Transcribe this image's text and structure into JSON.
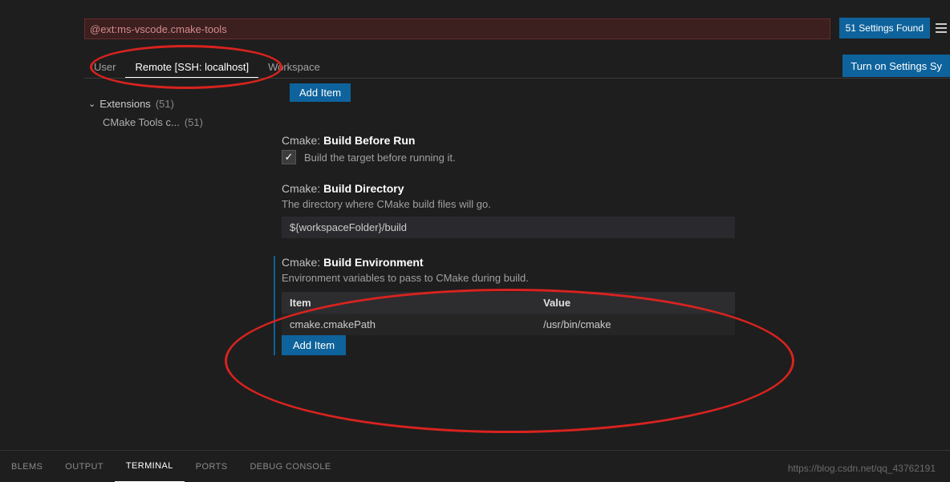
{
  "search": {
    "value": "@ext:ms-vscode.cmake-tools"
  },
  "found": "51 Settings Found",
  "tabs": {
    "user": "User",
    "remote": "Remote [SSH: localhost]",
    "workspace": "Workspace"
  },
  "sync_button": "Turn on Settings Sy",
  "sidebar": {
    "ext_label": "Extensions",
    "ext_count": "(51)",
    "cmake_label": "CMake Tools c...",
    "cmake_count": "(51)"
  },
  "buttons": {
    "add_item": "Add Item"
  },
  "settings": {
    "prefix": "Cmake:",
    "build_before_run": {
      "name": "Build Before Run",
      "desc": "Build the target before running it."
    },
    "build_directory": {
      "name": "Build Directory",
      "desc": "The directory where CMake build files will go.",
      "value": "${workspaceFolder}/build"
    },
    "build_env": {
      "name": "Build Environment",
      "desc": "Environment variables to pass to CMake during build.",
      "col_item": "Item",
      "col_value": "Value",
      "row_item": "cmake.cmakePath",
      "row_value": "/usr/bin/cmake"
    }
  },
  "bottom_tabs": {
    "problems": "BLEMS",
    "output": "OUTPUT",
    "terminal": "TERMINAL",
    "ports": "PORTS",
    "debug": "DEBUG CONSOLE"
  },
  "watermark": "https://blog.csdn.net/qq_43762191"
}
